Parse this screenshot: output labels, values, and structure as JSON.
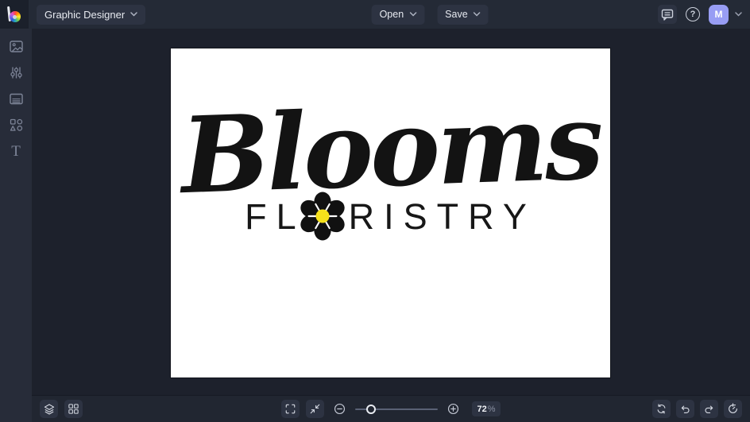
{
  "topbar": {
    "app_menu_label": "Graphic Designer",
    "open_label": "Open",
    "save_label": "Save",
    "help_glyph": "?",
    "avatar_initial": "M"
  },
  "sidebar": {
    "items": [
      {
        "name": "image-manager",
        "icon": "image-icon"
      },
      {
        "name": "edit-adjustments",
        "icon": "sliders-icon"
      },
      {
        "name": "templates",
        "icon": "template-icon"
      },
      {
        "name": "graphics-shapes",
        "icon": "shapes-icon"
      },
      {
        "name": "text-tool",
        "icon": "text-icon",
        "glyph": "T"
      }
    ]
  },
  "canvas": {
    "design": {
      "script_text": "Blooms",
      "caps_before_flower": "FL",
      "caps_after_flower": "RISTRY",
      "flower_icon": "flower-icon",
      "flower_center_color": "#f6e21b",
      "ink_color": "#131313",
      "artboard_color": "#ffffff"
    }
  },
  "bottombar": {
    "zoom_value": "72",
    "zoom_unit": "%",
    "left_tools": [
      "layers-icon",
      "grid-icon"
    ],
    "center_tools": [
      "fullscreen-icon",
      "fit-screen-icon",
      "zoom-out-icon",
      "zoom-slider",
      "zoom-in-icon",
      "zoom-level"
    ],
    "right_tools": [
      "reset-icon",
      "undo-icon",
      "redo-icon",
      "history-icon"
    ]
  },
  "colors": {
    "topbar_bg": "#242a36",
    "sidebar_bg": "#272c39",
    "canvas_bg": "#1d212c",
    "bottombar_bg": "#212631",
    "button_bg": "#2d3342",
    "avatar_bg": "#989df4",
    "icon_bright": "#d6dae3",
    "icon_muted": "#7d8497",
    "flower_yellow": "#f6e21b"
  }
}
